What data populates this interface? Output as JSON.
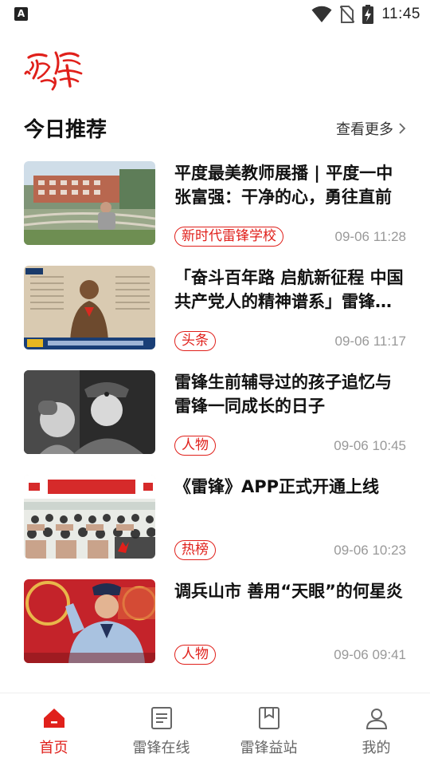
{
  "status_bar": {
    "time": "11:45",
    "app_badge": "A",
    "icons": [
      "wifi-icon",
      "no-sim-icon",
      "battery-charging-icon"
    ]
  },
  "brand": {
    "logo_text": "雷锋",
    "accent_color": "#e0201b"
  },
  "section": {
    "title": "今日推荐",
    "more_label": "查看更多"
  },
  "news": [
    {
      "title": "平度最美教师展播 | 平度一中张富强：干净的心，勇往直前",
      "tag": "新时代雷锋学校",
      "time": "09-06 11:28",
      "image": "teacher-campus-photo"
    },
    {
      "title": "「奋斗百年路 启航新征程 中国共产党人的精神谱系」雷锋精神",
      "tag": "头条",
      "time": "09-06 11:17",
      "image": "lei-feng-statue-photo"
    },
    {
      "title": "雷锋生前辅导过的孩子追忆与雷锋一同成长的日子",
      "tag": "人物",
      "time": "09-06 10:45",
      "image": "historic-bw-photo"
    },
    {
      "title": "《雷锋》APP正式开通上线",
      "tag": "热榜",
      "time": "09-06 10:23",
      "image": "launch-ceremony-photo"
    },
    {
      "title": "调兵山市 善用“天眼”的何星炎",
      "tag": "人物",
      "time": "09-06 09:41",
      "image": "police-officer-photo"
    }
  ],
  "bottom_nav": [
    {
      "label": "首页",
      "icon": "home-icon",
      "active": true
    },
    {
      "label": "雷锋在线",
      "icon": "document-icon",
      "active": false
    },
    {
      "label": "雷锋益站",
      "icon": "bookmark-book-icon",
      "active": false
    },
    {
      "label": "我的",
      "icon": "person-icon",
      "active": false
    }
  ]
}
